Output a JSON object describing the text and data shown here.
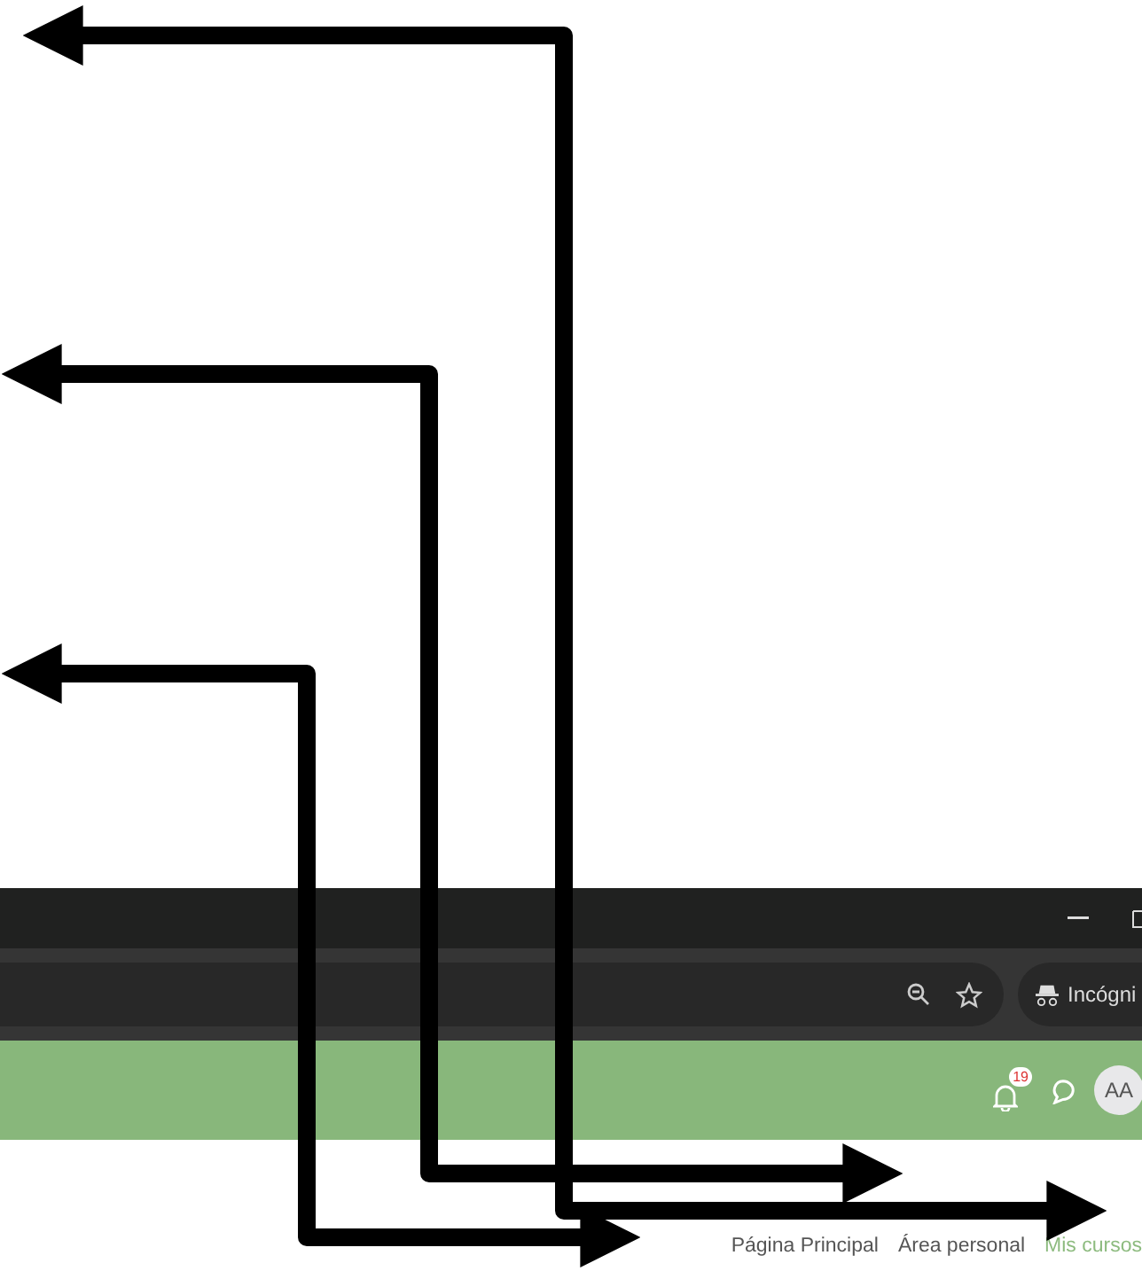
{
  "browser": {
    "incognito_label": "Incógni"
  },
  "site_header": {
    "notifications_count": "19",
    "avatar_initials": "AA"
  },
  "nav": [
    {
      "label": "Página Principal",
      "selected": false
    },
    {
      "label": "Área personal",
      "selected": false
    },
    {
      "label": "Mis cursos",
      "selected": true
    }
  ]
}
